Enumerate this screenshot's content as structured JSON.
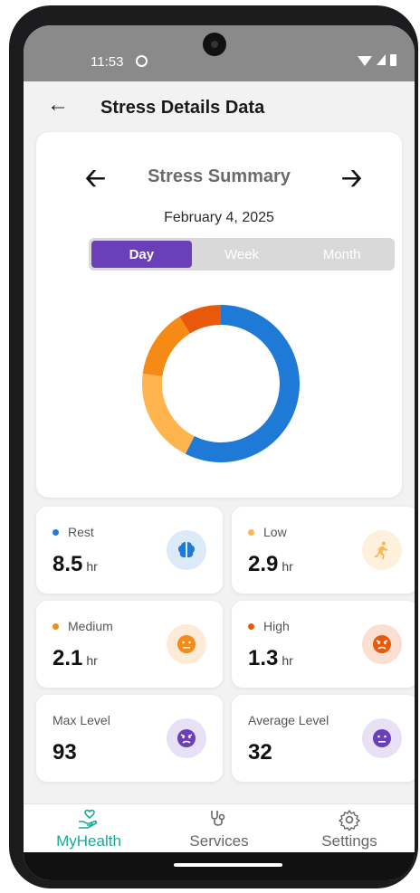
{
  "status_bar": {
    "time": "11:53"
  },
  "header": {
    "title": "Stress Details Data"
  },
  "summary": {
    "title": "Stress Summary",
    "date": "February 4, 2025",
    "tabs": [
      {
        "label": "Day",
        "active": true
      },
      {
        "label": "Week",
        "active": false
      },
      {
        "label": "Month",
        "active": false
      }
    ]
  },
  "chart_data": {
    "type": "pie",
    "categories": [
      "Rest",
      "Low",
      "Medium",
      "High"
    ],
    "values": [
      8.5,
      2.9,
      2.1,
      1.3
    ],
    "colors": [
      "#1e7ad6",
      "#ffb54d",
      "#f58a14",
      "#e8590c"
    ]
  },
  "stats": {
    "rest": {
      "label": "Rest",
      "value": "8.5",
      "unit": "hr",
      "dot_color": "#1e7ad6",
      "icon": "brain-icon"
    },
    "low": {
      "label": "Low",
      "value": "2.9",
      "unit": "hr",
      "dot_color": "#ffb54d",
      "icon": "running-icon"
    },
    "medium": {
      "label": "Medium",
      "value": "2.1",
      "unit": "hr",
      "dot_color": "#f58a14",
      "icon": "neutral-face-icon"
    },
    "high": {
      "label": "High",
      "value": "1.3",
      "unit": "hr",
      "dot_color": "#e8590c",
      "icon": "angry-face-icon"
    },
    "max": {
      "label": "Max Level",
      "value": "93",
      "icon": "angry-face-icon"
    },
    "average": {
      "label": "Average Level",
      "value": "32",
      "icon": "neutral-face-icon"
    }
  },
  "bottom_nav": {
    "items": [
      {
        "label": "MyHealth",
        "icon": "heart-hand-icon",
        "active": true
      },
      {
        "label": "Services",
        "icon": "stethoscope-icon",
        "active": false
      },
      {
        "label": "Settings",
        "icon": "gear-icon",
        "active": false
      }
    ]
  }
}
